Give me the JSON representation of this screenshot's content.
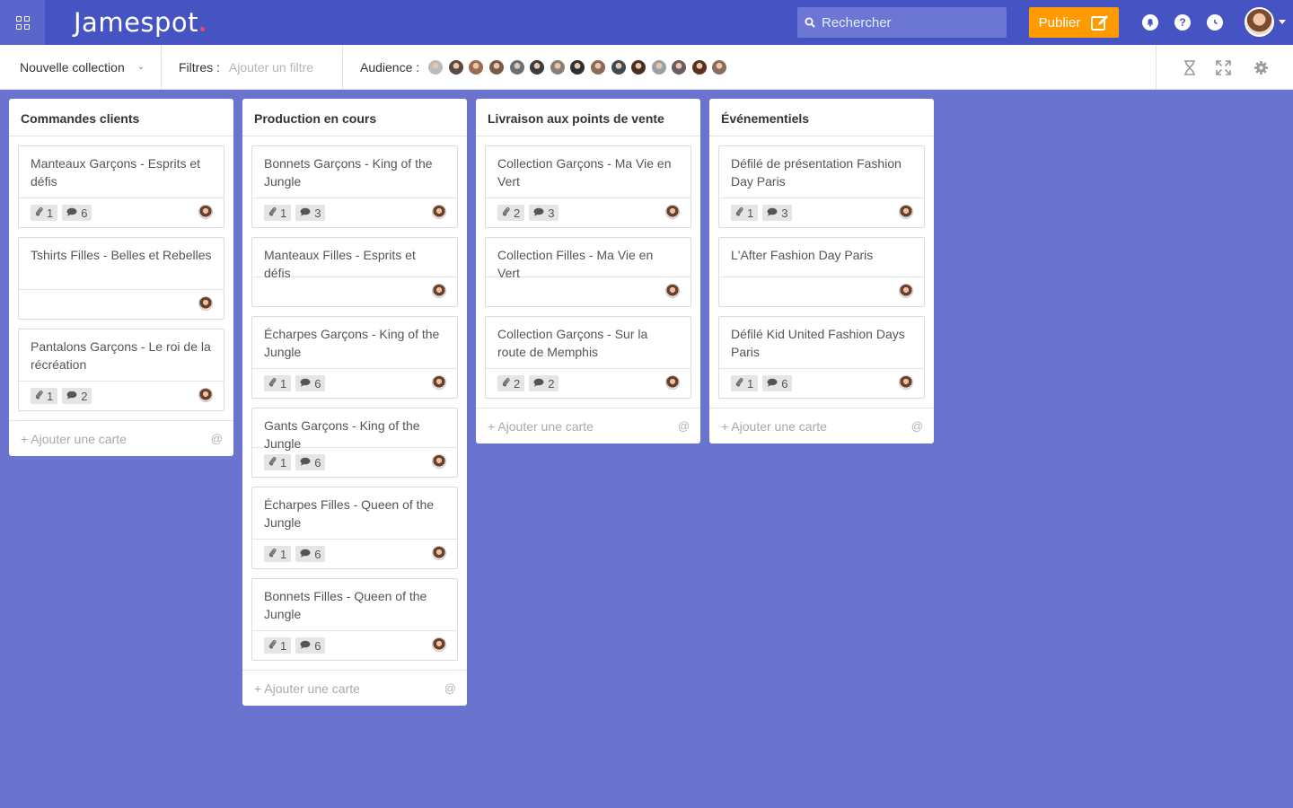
{
  "topbar": {
    "logo": "Jamespot",
    "search_placeholder": "Rechercher",
    "publish_label": "Publier",
    "notifications_icon": "bell-icon",
    "help_label": "?",
    "history_icon": "clock-icon"
  },
  "toolbar": {
    "collection_label": "Nouvelle collection",
    "filters_label": "Filtres :",
    "filter_placeholder": "Ajouter un filtre",
    "audience_label": "Audience :",
    "audience_colors": [
      "#bbbbbb",
      "#5a4a42",
      "#9a6b50",
      "#7a5a48",
      "#6a7078",
      "#3c3c3c",
      "#8a7f78",
      "#2f2f2f",
      "#8d6a55",
      "#3e4a52",
      "#4a2e24",
      "#9aa0a6",
      "#6d5a66",
      "#5b3020",
      "#8b6b5a"
    ]
  },
  "columns": [
    {
      "title": "Commandes clients",
      "footer": "+ Ajouter une carte",
      "cards": [
        {
          "title": "Manteaux Garçons - Esprits et défis",
          "attachments": "1",
          "comments": "6"
        },
        {
          "title": "Tshirts Filles - Belles et Rebelles",
          "attachments": null,
          "comments": null
        },
        {
          "title": "Pantalons Garçons - Le roi de la récréation",
          "attachments": "1",
          "comments": "2"
        }
      ]
    },
    {
      "title": "Production en cours",
      "footer": "+ Ajouter une carte",
      "cards": [
        {
          "title": "Bonnets Garçons - King of the Jungle",
          "attachments": "1",
          "comments": "3"
        },
        {
          "title": "Manteaux Filles - Esprits et défis",
          "attachments": null,
          "comments": null
        },
        {
          "title": "Écharpes Garçons - King of the Jungle",
          "attachments": "1",
          "comments": "6"
        },
        {
          "title": "Gants Garçons - King of the Jungle",
          "attachments": "1",
          "comments": "6"
        },
        {
          "title": "Écharpes Filles - Queen of the Jungle",
          "attachments": "1",
          "comments": "6"
        },
        {
          "title": "Bonnets Filles - Queen of the Jungle",
          "attachments": "1",
          "comments": "6"
        }
      ]
    },
    {
      "title": "Livraison aux points de vente",
      "footer": "+ Ajouter une carte",
      "cards": [
        {
          "title": "Collection Garçons - Ma Vie en Vert",
          "attachments": "2",
          "comments": "3"
        },
        {
          "title": "Collection Filles - Ma Vie en Vert",
          "attachments": null,
          "comments": null
        },
        {
          "title": "Collection Garçons - Sur la route de Memphis",
          "attachments": "2",
          "comments": "2"
        }
      ]
    },
    {
      "title": "Événementiels",
      "footer": "+ Ajouter une carte",
      "cards": [
        {
          "title": "Défilé de présentation Fashion Day Paris",
          "attachments": "1",
          "comments": "3"
        },
        {
          "title": "L'After Fashion Day Paris",
          "attachments": null,
          "comments": null
        },
        {
          "title": "Défilé Kid United Fashion Days Paris",
          "attachments": "1",
          "comments": "6"
        }
      ]
    }
  ]
}
